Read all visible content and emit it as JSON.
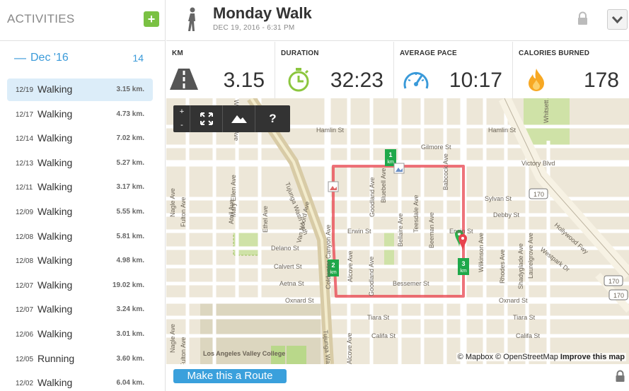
{
  "sidebar": {
    "title": "ACTIVITIES",
    "add_label": "+",
    "month": {
      "collapse_symbol": "—",
      "name": "Dec '16",
      "count": "14"
    },
    "items": [
      {
        "date": "12/19",
        "type": "Walking",
        "distance": "3.15 km."
      },
      {
        "date": "12/17",
        "type": "Walking",
        "distance": "4.73 km."
      },
      {
        "date": "12/14",
        "type": "Walking",
        "distance": "7.02 km."
      },
      {
        "date": "12/13",
        "type": "Walking",
        "distance": "5.27 km."
      },
      {
        "date": "12/11",
        "type": "Walking",
        "distance": "3.17 km."
      },
      {
        "date": "12/09",
        "type": "Walking",
        "distance": "5.55 km."
      },
      {
        "date": "12/08",
        "type": "Walking",
        "distance": "5.81 km."
      },
      {
        "date": "12/08",
        "type": "Walking",
        "distance": "4.98 km."
      },
      {
        "date": "12/07",
        "type": "Walking",
        "distance": "19.02 km."
      },
      {
        "date": "12/07",
        "type": "Walking",
        "distance": "3.24 km."
      },
      {
        "date": "12/06",
        "type": "Walking",
        "distance": "3.01 km."
      },
      {
        "date": "12/05",
        "type": "Running",
        "distance": "3.60 km."
      },
      {
        "date": "12/02",
        "type": "Walking",
        "distance": "6.04 km."
      }
    ]
  },
  "header": {
    "title": "Monday Walk",
    "subtitle": "DEC 19, 2016  -  6:31 PM"
  },
  "stats": [
    {
      "label": "KM",
      "value": "3.15",
      "icon": "road-icon"
    },
    {
      "label": "DURATION",
      "value": "32:23",
      "icon": "stopwatch-icon"
    },
    {
      "label": "AVERAGE PACE",
      "value": "10:17",
      "icon": "speedometer-icon"
    },
    {
      "label": "CALORIES BURNED",
      "value": "178",
      "icon": "flame-icon"
    }
  ],
  "map": {
    "zoom_in": "+",
    "zoom_out": "-",
    "help_label": "?",
    "attribution_mapbox": "© Mapbox",
    "attribution_osm": "© OpenStreetMap",
    "attribution_improve": "Improve this map",
    "km_markers": [
      "1\nkm",
      "2\nkm",
      "3\nkm"
    ],
    "streets": {
      "hamlin_w": "Hamlin St",
      "hamlin_e": "Hamlin St",
      "gilmore": "Gilmore St",
      "victory": "Victory Blvd",
      "sylvan": "Sylvan St",
      "debby": "Debby St",
      "erwin_w": "Erwin St",
      "erwin_e": "Erwin St",
      "delano": "Delano St",
      "calvert": "Calvert St",
      "aetna": "Aetna St",
      "bessemer": "Bessemer St",
      "oxnard_w": "Oxnard St",
      "oxnard_e": "Oxnard St",
      "tiara_w": "Tiara St",
      "tiara_e": "Tiara St",
      "califa_w": "Califa St",
      "califa_e": "Califa St",
      "westpark": "Westpark Dr",
      "hollywood": "Hollywood Fwy",
      "tujunga_path": "Tujunga Wash Path",
      "tujunga_n": "Tujunga Wash",
      "woodman": "Woodman Ave",
      "fulton": "Fulton Ave",
      "nagle": "Nagle Ave",
      "mary_ellen": "Mary Ellen Ave",
      "ethel": "Ethel Ave",
      "van_noord": "Van Noord Ave",
      "atoll": "Atoll Ave",
      "goodland": "Goodland Ave",
      "goodland_s": "Goodland Ave",
      "bluebell": "Bluebell Ave",
      "alcove": "Alcove Ave",
      "alcove_s": "Alcove Ave",
      "bellaire": "Bellaire Ave",
      "teesdale": "Teesdale Ave",
      "beeman": "Beeman Ave",
      "babcock": "Babcock Ave",
      "wilkinson": "Wilkinson Ave",
      "rhodes": "Rhodes Ave",
      "shadyglade": "Shadyglade Ave",
      "laurelgrove": "Laurelgrove Ave",
      "whitsett": "Whitsett Ave",
      "coldwater": "Coldwater Canyon Ave",
      "college": "Los Angeles Valley College",
      "hwy170a": "170",
      "hwy170b": "170",
      "hwy170c": "170"
    }
  },
  "footer": {
    "route_button": "Make this a Route"
  }
}
